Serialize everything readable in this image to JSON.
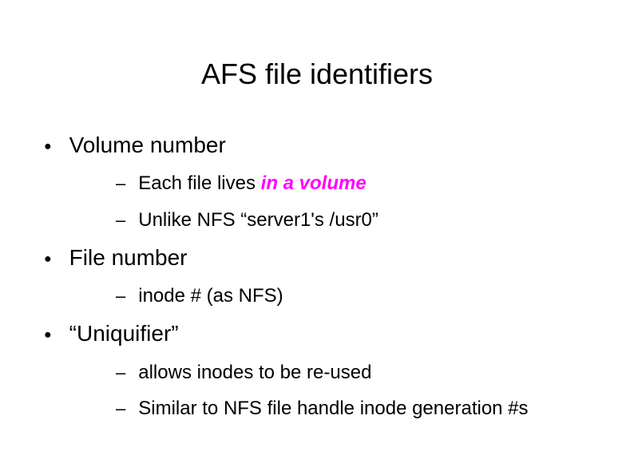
{
  "title": "AFS file identifiers",
  "items": [
    {
      "text": "Volume number",
      "children": [
        {
          "prefix": "Each file lives ",
          "emph": "in a volume",
          "suffix": ""
        },
        {
          "prefix": "Unlike NFS “server1's /usr0”",
          "emph": "",
          "suffix": ""
        }
      ]
    },
    {
      "text": "File number",
      "children": [
        {
          "prefix": "inode # (as NFS)",
          "emph": "",
          "suffix": ""
        }
      ]
    },
    {
      "text": "“Uniquifier”",
      "children": [
        {
          "prefix": "allows inodes to be re-used",
          "emph": "",
          "suffix": ""
        },
        {
          "prefix": "Similar to NFS file handle inode generation #s",
          "emph": "",
          "suffix": ""
        }
      ]
    }
  ],
  "colors": {
    "emphasis": "#ff00ff",
    "text": "#000000",
    "background": "#ffffff"
  }
}
